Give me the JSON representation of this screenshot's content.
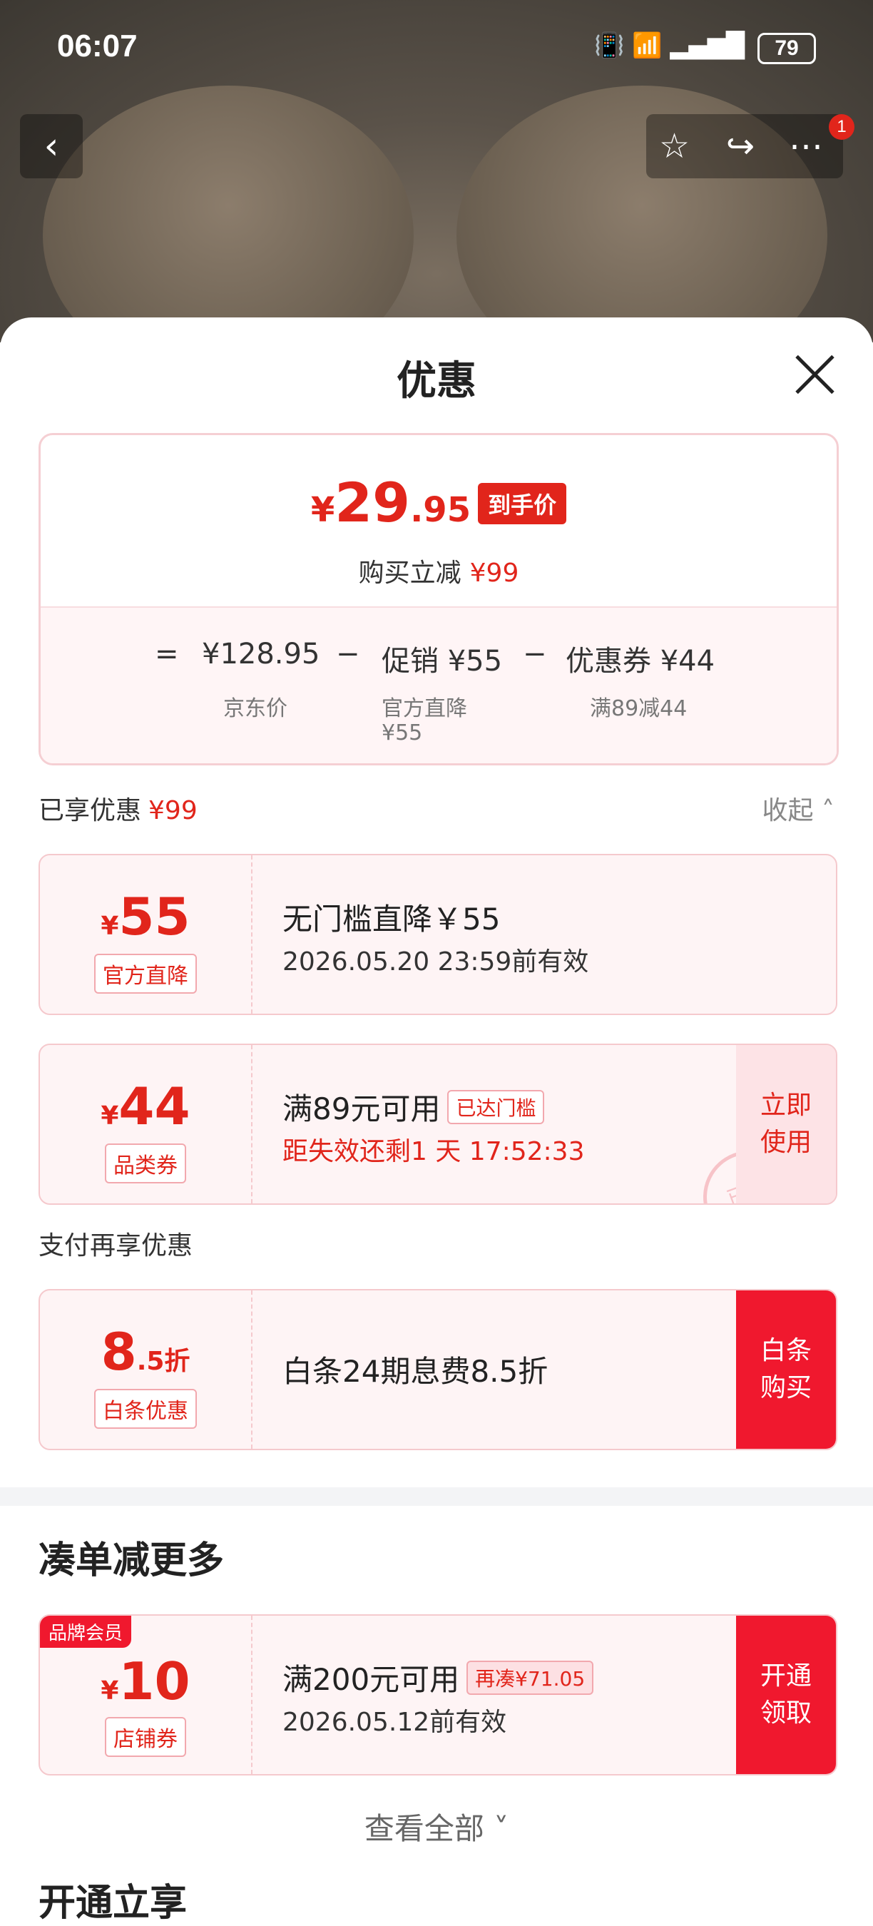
{
  "status": {
    "time": "06:07",
    "battery": "79"
  },
  "sheet": {
    "title": "优惠"
  },
  "price": {
    "currency": "¥",
    "final_int": "29",
    "final_dec": ".95",
    "final_tag": "到手价",
    "reduce_label": "购买立减",
    "reduce_value": "¥99",
    "eq": "=",
    "jd_price": "¥128.95",
    "minus1": "−",
    "promo": "促销 ¥55",
    "minus2": "−",
    "coupon": "优惠券 ¥44",
    "jd_label": "京东价",
    "promo_label": "官方直降",
    "promo_sub": "¥55",
    "coupon_label": "满89减44"
  },
  "enjoyed": {
    "label": "已享优惠",
    "value": "¥99",
    "collapse": "收起"
  },
  "coupons": [
    {
      "currency": "¥",
      "amount": "55",
      "kind": "官方直降",
      "line1": "无门槛直降￥55",
      "line2": "2026.05.20 23:59前有效"
    },
    {
      "currency": "¥",
      "amount": "44",
      "kind": "品类券",
      "line1": "满89元可用",
      "chip": "已达门槛",
      "line2": "距失效还剩1 天 17:52:33",
      "action": "立即使用",
      "stamp": "已领"
    }
  ],
  "payment": {
    "label": "支付再享优惠",
    "amount": "8",
    "suffix": ".5折",
    "kind": "白条优惠",
    "line1": "白条24期息费8.5折",
    "action": "白条购买"
  },
  "more": {
    "title": "凑单减更多",
    "brand_tag": "品牌会员",
    "currency": "¥",
    "amount": "10",
    "kind": "店铺券",
    "line1": "满200元可用",
    "chip": "再凑¥71.05",
    "line2": "2026.05.12前有效",
    "action": "开通领取",
    "view_all": "查看全部"
  },
  "open": {
    "title": "开通立享"
  },
  "icons": {
    "back": "chevron-left-icon",
    "favorite": "star-icon",
    "share": "share-icon",
    "more": "more-icon",
    "close": "close-icon"
  },
  "badge": "1"
}
